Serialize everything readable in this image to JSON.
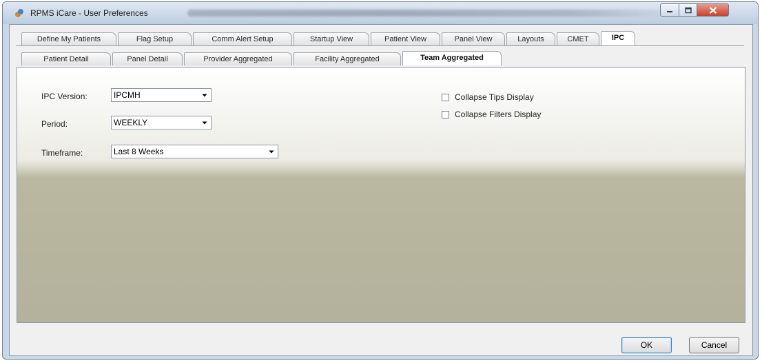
{
  "window": {
    "title": "RPMS iCare - User Preferences"
  },
  "tabs_row1": [
    {
      "label": "Define My Patients"
    },
    {
      "label": "Flag Setup"
    },
    {
      "label": "Comm Alert Setup"
    },
    {
      "label": "Startup View"
    },
    {
      "label": "Patient View"
    },
    {
      "label": "Panel View"
    },
    {
      "label": "Layouts"
    },
    {
      "label": "CMET"
    },
    {
      "label": "IPC",
      "active": true
    }
  ],
  "tabs_row2": [
    {
      "label": "Patient Detail"
    },
    {
      "label": "Panel Detail"
    },
    {
      "label": "Provider Aggregated"
    },
    {
      "label": "Facility Aggregated"
    },
    {
      "label": "Team Aggregated",
      "active": true
    }
  ],
  "form": {
    "ipc_version": {
      "label": "IPC Version:",
      "value": "IPCMH"
    },
    "period": {
      "label": "Period:",
      "value": "WEEKLY"
    },
    "timeframe": {
      "label": "Timeframe:",
      "value": "Last 8 Weeks"
    },
    "collapse_tips": {
      "label": "Collapse Tips Display",
      "checked": false
    },
    "collapse_filters": {
      "label": "Collapse Filters Display",
      "checked": false
    }
  },
  "buttons": {
    "ok": "OK",
    "cancel": "Cancel"
  },
  "icons": {
    "app": "rpms-app-icon",
    "minimize": "minimize-icon",
    "maximize": "maximize-icon",
    "close": "close-icon",
    "dropdown": "chevron-down-icon"
  }
}
